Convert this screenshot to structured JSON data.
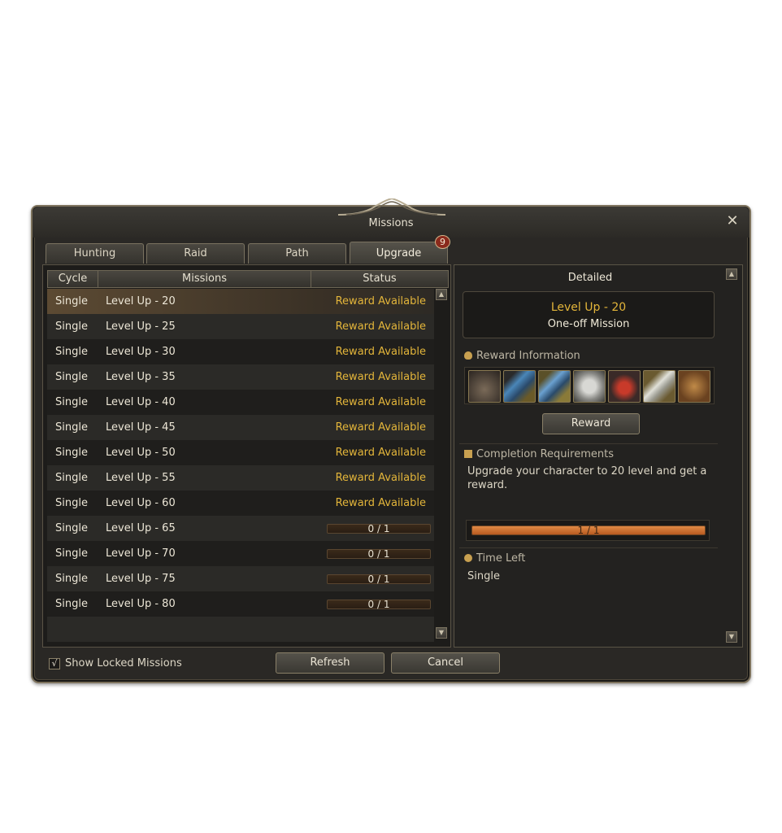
{
  "window": {
    "title": "Missions"
  },
  "tabs": [
    {
      "label": "Hunting"
    },
    {
      "label": "Raid"
    },
    {
      "label": "Path"
    },
    {
      "label": "Upgrade",
      "badge": "9"
    }
  ],
  "list": {
    "headers": {
      "cycle": "Cycle",
      "missions": "Missions",
      "status": "Status"
    },
    "rows": [
      {
        "cycle": "Single",
        "mission": "Level Up - 20",
        "status": "Reward Available"
      },
      {
        "cycle": "Single",
        "mission": "Level Up - 25",
        "status": "Reward Available"
      },
      {
        "cycle": "Single",
        "mission": "Level Up - 30",
        "status": "Reward Available"
      },
      {
        "cycle": "Single",
        "mission": "Level Up - 35",
        "status": "Reward Available"
      },
      {
        "cycle": "Single",
        "mission": "Level Up - 40",
        "status": "Reward Available"
      },
      {
        "cycle": "Single",
        "mission": "Level Up - 45",
        "status": "Reward Available"
      },
      {
        "cycle": "Single",
        "mission": "Level Up - 50",
        "status": "Reward Available"
      },
      {
        "cycle": "Single",
        "mission": "Level Up - 55",
        "status": "Reward Available"
      },
      {
        "cycle": "Single",
        "mission": "Level Up - 60",
        "status": "Reward Available"
      },
      {
        "cycle": "Single",
        "mission": "Level Up - 65",
        "progress": "0 / 1"
      },
      {
        "cycle": "Single",
        "mission": "Level Up - 70",
        "progress": "0 / 1"
      },
      {
        "cycle": "Single",
        "mission": "Level Up - 75",
        "progress": "0 / 1"
      },
      {
        "cycle": "Single",
        "mission": "Level Up - 80",
        "progress": "0 / 1"
      }
    ]
  },
  "detail": {
    "title": "Detailed",
    "mission_name": "Level Up - 20",
    "mission_type": "One-off Mission",
    "reward_info_label": "Reward Information",
    "reward_items": [
      {
        "icon": "soulshot-pouch-icon",
        "color": "#6a5a48"
      },
      {
        "icon": "blue-scroll-icon",
        "color": "#3a6a8a"
      },
      {
        "icon": "enchant-scroll-icon",
        "color": "#4a7aa0"
      },
      {
        "icon": "silver-coins-icon",
        "color": "#9a9a96"
      },
      {
        "icon": "red-potion-icon",
        "color": "#8a2a22"
      },
      {
        "icon": "elixir-vial-icon",
        "color": "#a8a8a0"
      },
      {
        "icon": "leather-bag-icon",
        "color": "#9a6a38"
      }
    ],
    "reward_button": "Reward",
    "requirements_label": "Completion Requirements",
    "requirements_text": "Upgrade your character to 20 level and get a reward.",
    "progress_text": "1 / 1",
    "time_left_label": "Time Left",
    "time_left_value": "Single"
  },
  "footer": {
    "show_locked_label": "Show Locked Missions",
    "show_locked_checked": "√",
    "refresh_label": "Refresh",
    "cancel_label": "Cancel"
  }
}
